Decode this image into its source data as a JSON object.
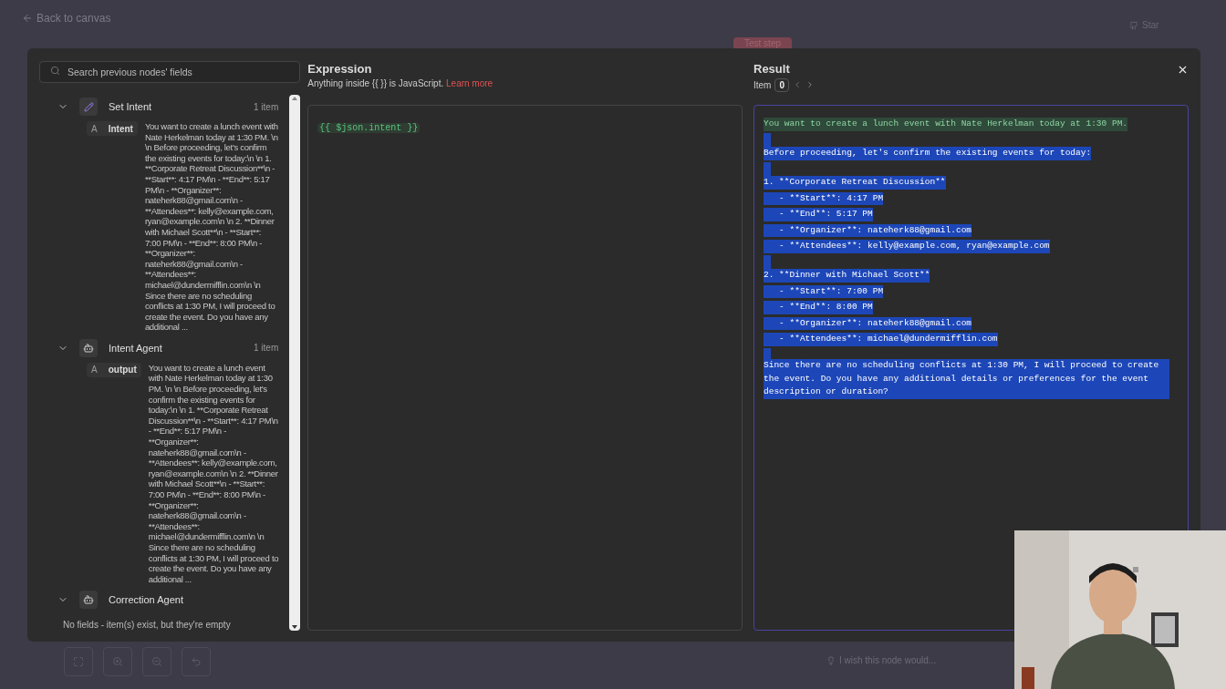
{
  "background": {
    "back_link": "Back to canvas",
    "test_step": "Test step",
    "star": "Star",
    "hint": "I wish this node would..."
  },
  "search": {
    "placeholder": "Search previous nodes' fields"
  },
  "nodes": [
    {
      "name": "Set Intent",
      "kind": "set",
      "count": "1 item",
      "expanded": true,
      "fields": [
        {
          "type": "A",
          "name": "Intent",
          "value": "You want to create a lunch event with Nate Herkelman today at 1:30 PM. \\n \\n Before proceeding, let's confirm the existing events for today:\\n \\n 1. **Corporate Retreat Discussion**\\n - **Start**: 4:17 PM\\n - **End**: 5:17 PM\\n - **Organizer**: nateherk88@gmail.com\\n - **Attendees**: kelly@example.com, ryan@example.com\\n \\n 2. **Dinner with Michael Scott**\\n - **Start**: 7:00 PM\\n - **End**: 8:00 PM\\n - **Organizer**: nateherk88@gmail.com\\n - **Attendees**: michael@dundermifflin.com\\n \\n Since there are no scheduling conflicts at 1:30 PM, I will proceed to create the event. Do you have any additional ..."
        }
      ]
    },
    {
      "name": "Intent Agent",
      "kind": "agent",
      "count": "1 item",
      "expanded": true,
      "fields": [
        {
          "type": "A",
          "name": "output",
          "value": "You want to create a lunch event with Nate Herkelman today at 1:30 PM. \\n \\n Before proceeding, let's confirm the existing events for today:\\n \\n 1. **Corporate Retreat Discussion**\\n - **Start**: 4:17 PM\\n - **End**: 5:17 PM\\n - **Organizer**: nateherk88@gmail.com\\n - **Attendees**: kelly@example.com, ryan@example.com\\n \\n 2. **Dinner with Michael Scott**\\n - **Start**: 7:00 PM\\n - **End**: 8:00 PM\\n - **Organizer**: nateherk88@gmail.com\\n - **Attendees**: michael@dundermifflin.com\\n \\n Since there are no scheduling conflicts at 1:30 PM, I will proceed to create the event. Do you have any additional ..."
        }
      ]
    },
    {
      "name": "Correction Agent",
      "kind": "agent",
      "expanded": true,
      "empty_note": "No fields - item(s) exist, but they're empty"
    }
  ],
  "expression": {
    "title": "Expression",
    "hint": "Anything inside {{  }} is JavaScript.",
    "link": "Learn more",
    "code": "{{ $json.intent }}"
  },
  "result": {
    "title": "Result",
    "item_label": "Item",
    "item_index": "0",
    "lines": [
      {
        "kind": "text",
        "text": "You want to create a lunch event with Nate Herkelman today at 1:30 PM.",
        "selected": false
      },
      {
        "kind": "blank",
        "selected": true
      },
      {
        "kind": "text",
        "text": "Before proceeding, let's confirm the existing events for today:",
        "selected": true
      },
      {
        "kind": "blank",
        "selected": true
      },
      {
        "kind": "text",
        "text": "1. **Corporate Retreat Discussion**",
        "selected": true
      },
      {
        "kind": "text",
        "text": "   - **Start**: 4:17 PM",
        "selected": true
      },
      {
        "kind": "text",
        "text": "   - **End**: 5:17 PM",
        "selected": true
      },
      {
        "kind": "text",
        "text": "   - **Organizer**: nateherk88@gmail.com",
        "selected": true
      },
      {
        "kind": "text",
        "text": "   - **Attendees**: kelly@example.com, ryan@example.com",
        "selected": true
      },
      {
        "kind": "blank",
        "selected": true
      },
      {
        "kind": "text",
        "text": "2. **Dinner with Michael Scott**",
        "selected": true
      },
      {
        "kind": "text",
        "text": "   - **Start**: 7:00 PM",
        "selected": true
      },
      {
        "kind": "text",
        "text": "   - **End**: 8:00 PM",
        "selected": true
      },
      {
        "kind": "text",
        "text": "   - **Organizer**: nateherk88@gmail.com",
        "selected": true
      },
      {
        "kind": "text",
        "text": "   - **Attendees**: michael@dundermifflin.com",
        "selected": true
      },
      {
        "kind": "blank",
        "selected": true
      },
      {
        "kind": "text",
        "text": "Since there are no scheduling conflicts at 1:30 PM, I will proceed to create the event. Do you have any additional details or preferences for the event description or duration?",
        "selected": true
      }
    ]
  }
}
